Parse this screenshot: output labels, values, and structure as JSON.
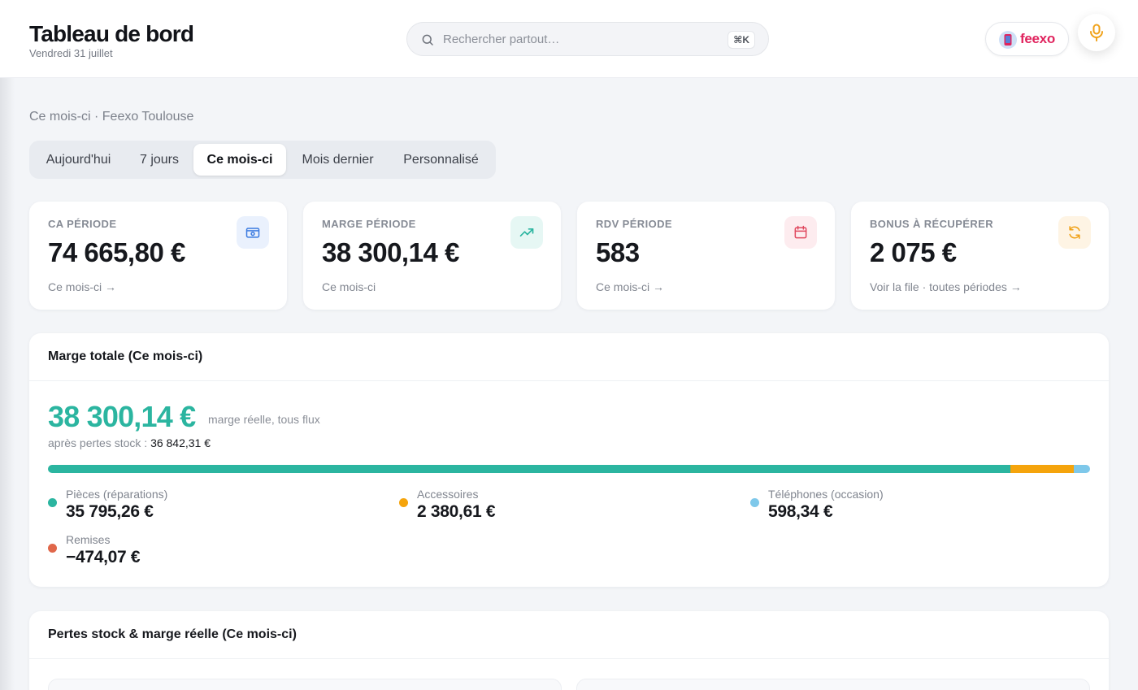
{
  "header": {
    "title": "Tableau de bord",
    "date": "Vendredi 31 juillet",
    "search_placeholder": "Rechercher partout…",
    "search_shortcut": "⌘K",
    "brand": "feexo"
  },
  "context": "Ce mois-ci · Feexo Toulouse",
  "tabs": [
    {
      "label": "Aujourd'hui",
      "active": false
    },
    {
      "label": "7 jours",
      "active": false
    },
    {
      "label": "Ce mois-ci",
      "active": true
    },
    {
      "label": "Mois dernier",
      "active": false
    },
    {
      "label": "Personnalisé",
      "active": false
    }
  ],
  "kpis": [
    {
      "label": "CA PÉRIODE",
      "value": "74 665,80 €",
      "link": "Ce mois-ci →",
      "icon": "wallet-icon",
      "color": "#3b7be0",
      "bg": "#eaf1fd"
    },
    {
      "label": "MARGE PÉRIODE",
      "value": "38 300,14 €",
      "link": "Ce mois-ci",
      "icon": "trending-up-icon",
      "color": "#2bb5a0",
      "bg": "#e6f7f4"
    },
    {
      "label": "RDV PÉRIODE",
      "value": "583",
      "link": "Ce mois-ci →",
      "icon": "calendar-icon",
      "color": "#e0485f",
      "bg": "#fdecef"
    },
    {
      "label": "BONUS À RÉCUPÉRER",
      "value": "2 075 €",
      "link": "Voir la file · toutes périodes →",
      "icon": "refresh-icon",
      "color": "#f0a21a",
      "bg": "#fef4e4"
    }
  ],
  "margin_panel": {
    "title": "Marge totale (Ce mois-ci)",
    "value": "38 300,14 €",
    "caption": "marge réelle, tous flux",
    "after_loss_label": "après pertes stock : ",
    "after_loss_value": "36 842,31 €",
    "segments": [
      {
        "name": "Pièces (réparations)",
        "value": 35795.26,
        "display": "35 795,26 €",
        "color": "#2bb5a0"
      },
      {
        "name": "Accessoires",
        "value": 2380.61,
        "display": "2 380,61 €",
        "color": "#f5a40c"
      },
      {
        "name": "Téléphones (occasion)",
        "value": 598.34,
        "display": "598,34 €",
        "color": "#7ec8ea"
      },
      {
        "name": "Remises",
        "value": -474.07,
        "display": "−474,07 €",
        "color": "#e0674a"
      }
    ]
  },
  "loss_panel": {
    "title": "Pertes stock & marge réelle (Ce mois-ci)"
  }
}
